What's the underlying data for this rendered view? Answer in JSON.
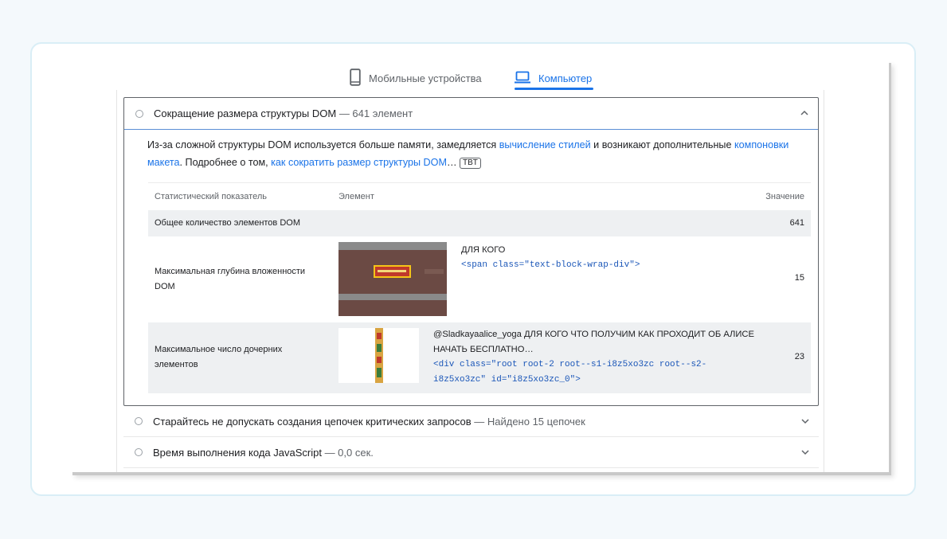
{
  "tabs": [
    {
      "label": "Мобильные устройства",
      "icon": "smartphone-icon",
      "active": false
    },
    {
      "label": "Компьютер",
      "icon": "laptop-icon",
      "active": true
    }
  ],
  "colors": {
    "accent": "#1a73e8",
    "code": "#1a56b8",
    "muted": "#5f6368",
    "highlight": "#ef6c00"
  },
  "audit": {
    "title": "Сокращение размера структуры DOM",
    "value": "— 641 элемент",
    "expanded": true,
    "description": {
      "part1": "Из-за сложной структуры DOM используется больше памяти, замедляется ",
      "link1": "вычисление стилей",
      "part2": " и возникают дополнительные ",
      "link2": "компоновки макета",
      "part3": ". Подробнее о том, ",
      "link3": "как сократить размер структуры DOM",
      "part4": "…",
      "badge": "TBT"
    },
    "table": {
      "headers": [
        "Статистический показатель",
        "Элемент",
        "Значение"
      ],
      "rows": [
        {
          "metric": "Общее количество элементов DOM",
          "value": "641"
        },
        {
          "metric": "Максимальная глубина вложенности DOM",
          "node_text": "ДЛЯ КОГО",
          "snippet": "<span class=\"text-block-wrap-div\">",
          "value": "15"
        },
        {
          "metric": "Максимальное число дочерних элементов",
          "node_text": "@Sladkayaalice_yoga ДЛЯ КОГО ЧТО ПОЛУЧИМ КАК ПРОХОДИТ ОБ АЛИСЕ НАЧАТЬ БЕСПЛАТНО…",
          "snippet": "<div class=\"root root-2 root--s1-i8z5xo3zc root--s2-i8z5xo3zc\" id=\"i8z5xo3zc_0\">",
          "value": "23"
        }
      ]
    }
  },
  "other_audits": [
    {
      "title": "Старайтесь не допускать создания цепочек критических запросов",
      "value": "— Найдено 15 цепочек"
    },
    {
      "title": "Время выполнения кода JavaScript",
      "value": "— 0,0 сек."
    }
  ]
}
